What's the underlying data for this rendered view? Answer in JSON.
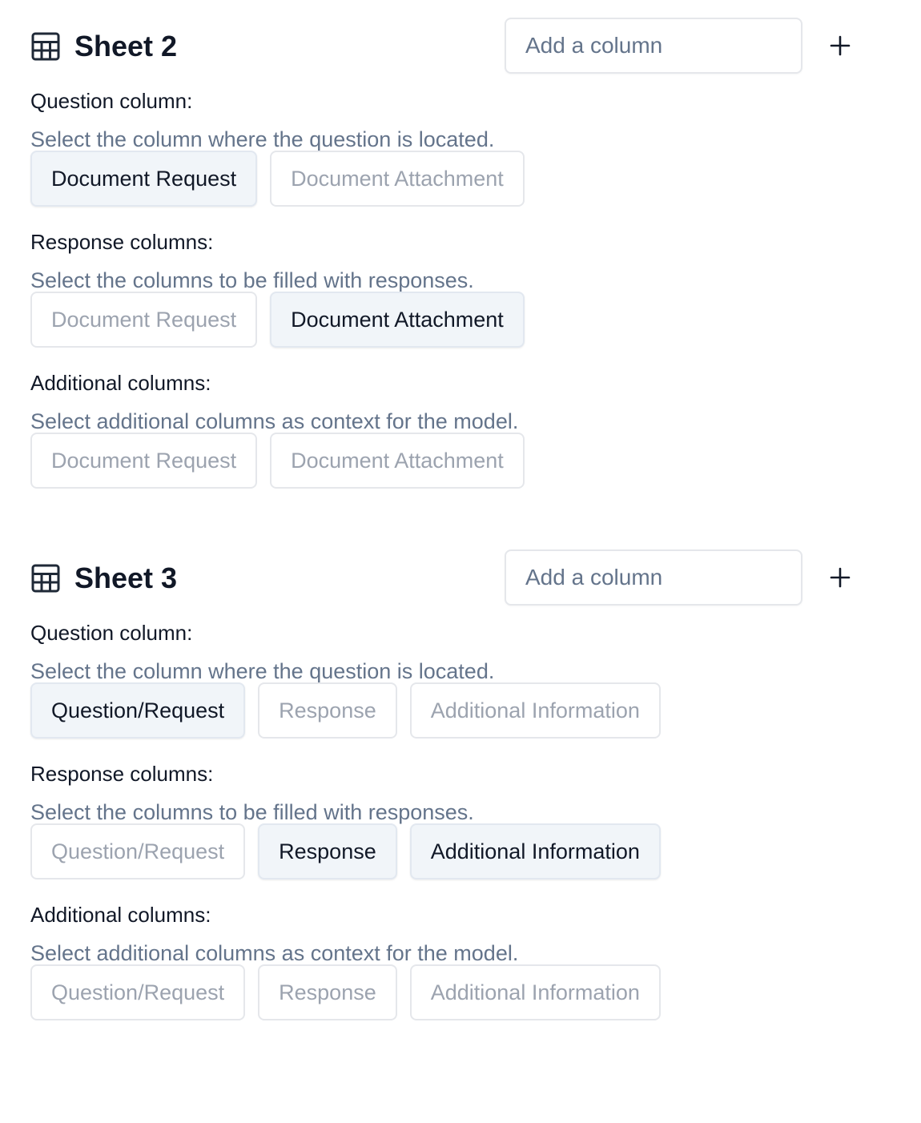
{
  "sheets": [
    {
      "title": "Sheet 2",
      "add_column_placeholder": "Add a column",
      "groups": [
        {
          "label": "Question column:",
          "description": "Select the column where the question is located.",
          "options": [
            {
              "label": "Document Request",
              "selected": true
            },
            {
              "label": "Document Attachment",
              "selected": false
            }
          ]
        },
        {
          "label": "Response columns:",
          "description": "Select the columns to be filled with responses.",
          "options": [
            {
              "label": "Document Request",
              "selected": false
            },
            {
              "label": "Document Attachment",
              "selected": true
            }
          ]
        },
        {
          "label": "Additional columns:",
          "description": "Select additional columns as context for the model.",
          "options": [
            {
              "label": "Document Request",
              "selected": false
            },
            {
              "label": "Document Attachment",
              "selected": false
            }
          ]
        }
      ]
    },
    {
      "title": "Sheet 3",
      "add_column_placeholder": "Add a column",
      "groups": [
        {
          "label": "Question column:",
          "description": "Select the column where the question is located.",
          "options": [
            {
              "label": "Question/Request",
              "selected": true
            },
            {
              "label": "Response",
              "selected": false
            },
            {
              "label": "Additional Information",
              "selected": false
            }
          ]
        },
        {
          "label": "Response columns:",
          "description": "Select the columns to be filled with responses.",
          "options": [
            {
              "label": "Question/Request",
              "selected": false
            },
            {
              "label": "Response",
              "selected": true
            },
            {
              "label": "Additional Information",
              "selected": true
            }
          ]
        },
        {
          "label": "Additional columns:",
          "description": "Select additional columns as context for the model.",
          "options": [
            {
              "label": "Question/Request",
              "selected": false
            },
            {
              "label": "Response",
              "selected": false
            },
            {
              "label": "Additional Information",
              "selected": false
            }
          ]
        }
      ]
    }
  ],
  "icons": {
    "sheet_icon": "table-icon",
    "add_icon": "plus-icon"
  },
  "colors": {
    "text_primary": "#111827",
    "text_muted": "#64748b",
    "chip_unselected_text": "#9ca3af",
    "chip_selected_bg": "#f1f5f9",
    "border": "#e5e7eb"
  }
}
